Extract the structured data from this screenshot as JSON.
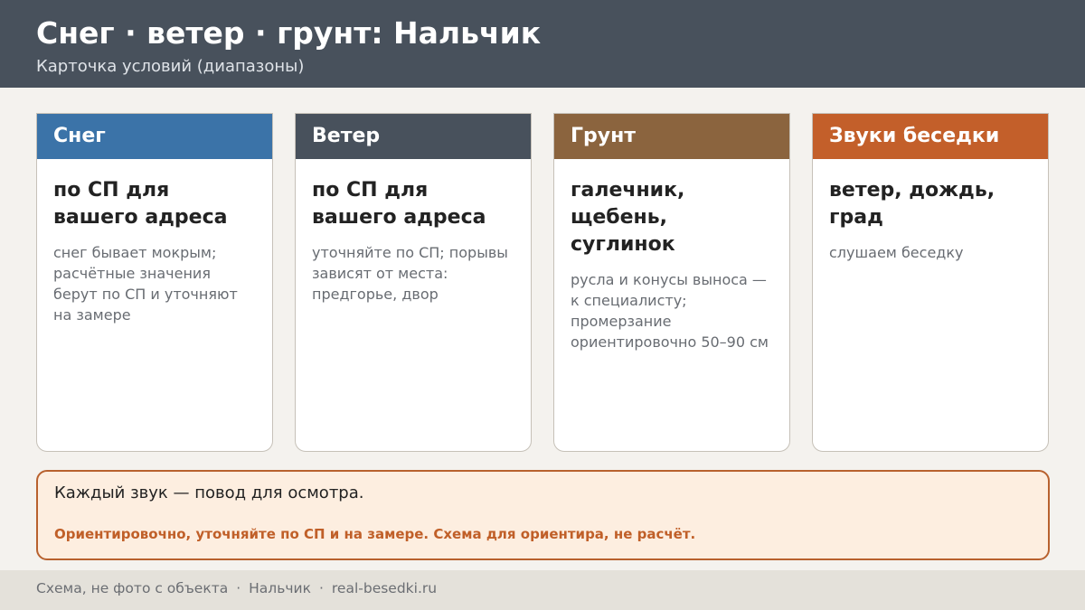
{
  "header": {
    "title": "Снег · ветер · грунт: Нальчик",
    "subtitle": "Карточка условий (диапазоны)"
  },
  "cards": [
    {
      "title": "Снег",
      "color": "#3b73a8",
      "main": "по СП для вашего адреса",
      "note": "снег бывает мокрым; расчётные значения берут по СП и уточняют на замере"
    },
    {
      "title": "Ветер",
      "color": "#48515c",
      "main": "по СП для вашего адреса",
      "note": "уточняйте по СП; порывы зависят от места: предгорье, двор"
    },
    {
      "title": "Грунт",
      "color": "#8b643e",
      "main": "галечник, щебень, суглинок",
      "note": "русла и конусы выноса — к специалисту; промерзание ориентировочно 50–90 см"
    },
    {
      "title": "Звуки беседки",
      "color": "#c35f2a",
      "main": "ветер, дождь, град",
      "note": "слушаем беседку"
    }
  ],
  "notice": {
    "main": "Каждый звук — повод для осмотра.",
    "warning": "Ориентировочно, уточняйте по СП и на замере. Схема для ориентира, не расчёт."
  },
  "footer": {
    "items": [
      "Схема, не фото с объекта",
      "Нальчик",
      "real-besedki.ru"
    ],
    "separator": "·"
  }
}
